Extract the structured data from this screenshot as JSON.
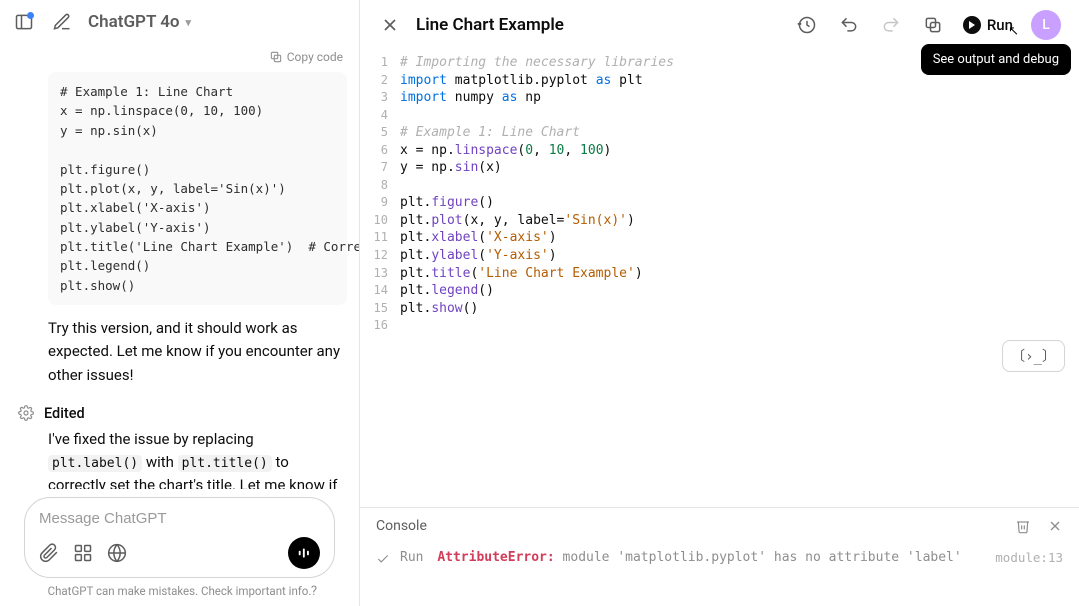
{
  "header": {
    "model": "ChatGPT 4o"
  },
  "chat": {
    "copy_code_label": "Copy code",
    "code_snippet": "# Example 1: Line Chart\nx = np.linspace(0, 10, 100)\ny = np.sin(x)\n\nplt.figure()\nplt.plot(x, y, label='Sin(x)')\nplt.xlabel('X-axis')\nplt.ylabel('Y-axis')\nplt.title('Line Chart Example')  # Corrected t\nplt.legend()\nplt.show()",
    "msg1": "Try this version, and it should work as expected. Let me know if you encounter any other issues!",
    "edited_label": "Edited",
    "msg2_pre": "I've fixed the issue by replacing ",
    "msg2_code1": "plt.label()",
    "msg2_mid": " with ",
    "msg2_code2": "plt.title()",
    "msg2_post": " to correctly set the chart's title. Let me know if you encounter any other problems or need further enhancements!"
  },
  "composer": {
    "placeholder": "Message ChatGPT"
  },
  "footer": {
    "disclaimer": "ChatGPT can make mistakes. Check important info.",
    "help": "?"
  },
  "right": {
    "title": "Line Chart Example",
    "run_label": "Run",
    "avatar_initial": "L",
    "tooltip": "See output and debug"
  },
  "editor": {
    "lines": [
      {
        "n": 1,
        "html": "<span class='tok-cmt'># Importing the necessary libraries</span>"
      },
      {
        "n": 2,
        "html": "<span class='tok-kw'>import</span> <span class='tok-mod'>matplotlib.pyplot</span> <span class='tok-kw'>as</span> <span class='tok-mod'>plt</span>"
      },
      {
        "n": 3,
        "html": "<span class='tok-kw'>import</span> <span class='tok-mod'>numpy</span> <span class='tok-kw'>as</span> <span class='tok-mod'>np</span>"
      },
      {
        "n": 4,
        "html": ""
      },
      {
        "n": 5,
        "html": "<span class='tok-cmt'># Example 1: Line Chart</span>"
      },
      {
        "n": 6,
        "html": "x <span class='tok-op'>=</span> np.<span class='tok-fn'>linspace</span>(<span class='tok-num'>0</span>, <span class='tok-num'>10</span>, <span class='tok-num'>100</span>)"
      },
      {
        "n": 7,
        "html": "y <span class='tok-op'>=</span> np.<span class='tok-fn'>sin</span>(x)"
      },
      {
        "n": 8,
        "html": ""
      },
      {
        "n": 9,
        "html": "plt.<span class='tok-fn'>figure</span>()"
      },
      {
        "n": 10,
        "html": "plt.<span class='tok-fn'>plot</span>(x, y, label=<span class='tok-str'>'Sin(x)'</span>)"
      },
      {
        "n": 11,
        "html": "plt.<span class='tok-fn'>xlabel</span>(<span class='tok-str'>'X-axis'</span>)"
      },
      {
        "n": 12,
        "html": "plt.<span class='tok-fn'>ylabel</span>(<span class='tok-str'>'Y-axis'</span>)"
      },
      {
        "n": 13,
        "html": "plt.<span class='tok-fn'>title</span>(<span class='tok-str'>'Line Chart Example'</span>)"
      },
      {
        "n": 14,
        "html": "plt.<span class='tok-fn'>legend</span>()"
      },
      {
        "n": 15,
        "html": "plt.<span class='tok-fn'>show</span>()"
      },
      {
        "n": 16,
        "html": ""
      }
    ]
  },
  "console": {
    "title": "Console",
    "toggle_glyph": "〔›_〕",
    "run_label": "Run",
    "err_name": "AttributeError:",
    "err_msg": " module 'matplotlib.pyplot' has no attribute 'label'",
    "err_loc": "module:13"
  }
}
